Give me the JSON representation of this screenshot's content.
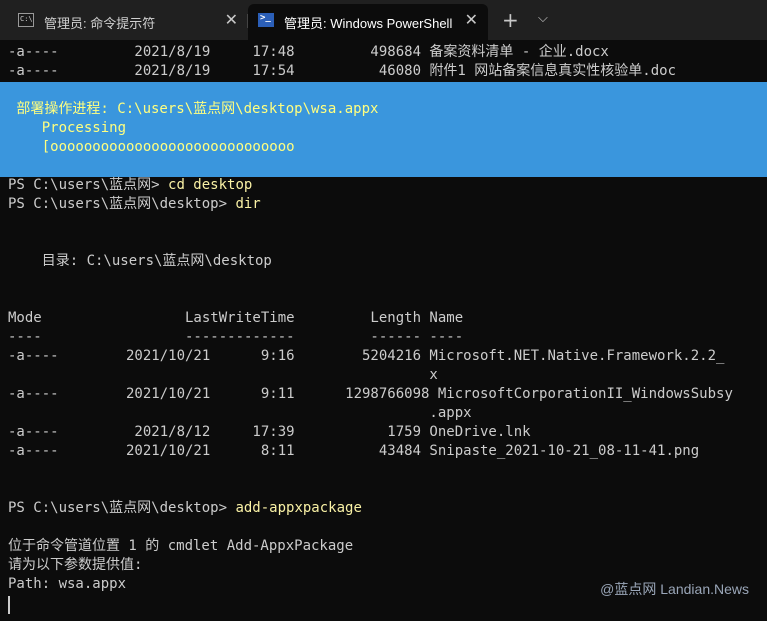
{
  "tabs": [
    {
      "label": "管理员: 命令提示符",
      "icon": "cmd-icon"
    },
    {
      "label": "管理员: Windows PowerShell",
      "icon": "powershell-icon"
    }
  ],
  "tabbar": {
    "close": "✕",
    "new_tab": "+",
    "dropdown": "⌵"
  },
  "top_rows": [
    "-a----         2021/8/19     17:48         498684 备案资料清单 - 企业.docx",
    "-a----         2021/8/19     17:54          46080 附件1 网站备案信息真实性核验单.doc"
  ],
  "progress_box": {
    "title": " 部署操作进程: C:\\users\\蓝点网\\desktop\\wsa.appx",
    "status": "    Processing",
    "bar": "    [ooooooooooooooooooooooooooooo"
  },
  "session": {
    "prompt_users": "PS C:\\users\\蓝点网>",
    "cmd_cd": "cd desktop",
    "prompt_desktop": "PS C:\\users\\蓝点网\\desktop>",
    "cmd_dir": "dir",
    "directory_line": "    目录: C:\\users\\蓝点网\\desktop",
    "header": "Mode                 LastWriteTime         Length Name",
    "separator": "----                 -------------         ------ ----",
    "rows": [
      "-a----        2021/10/21      9:16        5204216 Microsoft.NET.Native.Framework.2.2_",
      "                                                  x",
      "-a----        2021/10/21      9:11      1298766098 MicrosoftCorporationII_WindowsSubsy",
      "                                                  .appx",
      "-a----         2021/8/12     17:39           1759 OneDrive.lnk",
      "-a----        2021/10/21      8:11          43484 Snipaste_2021-10-21_08-11-41.png"
    ],
    "cmd_add": "add-appxpackage",
    "cmdlet_line": "位于命令管道位置 1 的 cmdlet Add-AppxPackage",
    "params_line": "请为以下参数提供值:",
    "path_line": "Path: wsa.appx"
  },
  "watermark": "@蓝点网 Landian.News"
}
